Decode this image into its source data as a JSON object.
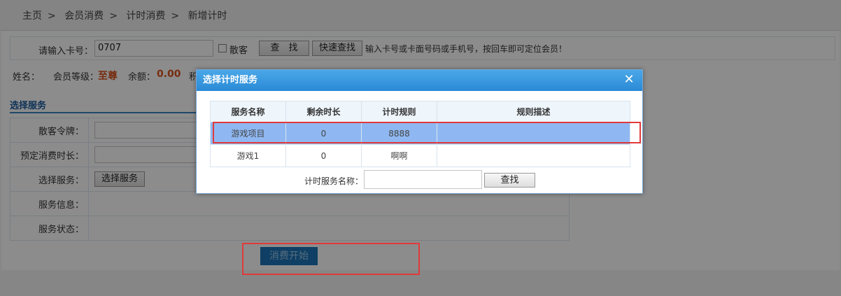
{
  "breadcrumb": {
    "items": [
      "主页",
      "会员消费",
      "计时消费",
      "新增计时"
    ],
    "separator": ">"
  },
  "card_row": {
    "label": "请输入卡号：",
    "card_value": "0707",
    "walkin_label": "散客",
    "search_label": "查　找",
    "quick_search_label": "快速查找",
    "hint": "输入卡号或卡面号码或手机号，按回车即可定位会员！"
  },
  "member_info": {
    "name_label": "姓名：",
    "level_label": "会员等级：",
    "level_value": "至尊",
    "balance_label": "余额：",
    "balance_value": "0.00",
    "points_label_partial": "积"
  },
  "section": {
    "title": "选择服务"
  },
  "form": {
    "walkin_token_label": "散客令牌：",
    "preset_duration_label": "预定消费时长：",
    "select_service_label": "选择服务：",
    "select_service_button": "选择服务",
    "service_info_label": "服务信息：",
    "service_status_label": "服务状态："
  },
  "start_button": "消费开始",
  "modal": {
    "title": "选择计时服务",
    "close_icon": "close-icon",
    "columns": [
      "服务名称",
      "剩余时长",
      "计时规则",
      "规则描述"
    ],
    "rows": [
      {
        "name": "游戏项目",
        "remaining": "0",
        "rule": "8888",
        "desc": ""
      },
      {
        "name": "游戏1",
        "remaining": "0",
        "rule": "啊啊",
        "desc": ""
      }
    ],
    "search_label": "计时服务名称：",
    "search_value": "",
    "search_button": "查找"
  },
  "colors": {
    "accent": "#2a89d6",
    "highlight_border": "#e03a3a",
    "selected_row": "#8fb8f2",
    "level_red": "#d9531e"
  }
}
